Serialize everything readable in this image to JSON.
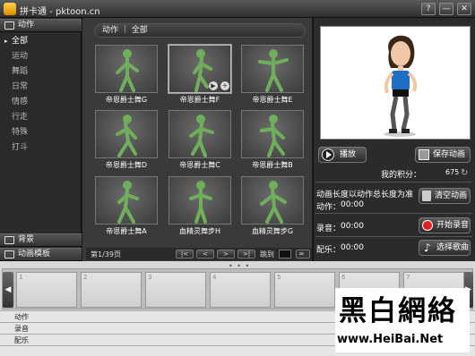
{
  "window": {
    "title": "拼卡通 - pktoon.cn",
    "help_label": "?",
    "minimize_label": "—",
    "maximize_label": "□",
    "close_label": "✕"
  },
  "sidebar": {
    "header": "动作",
    "items": [
      {
        "label": "全部",
        "selected": true
      },
      {
        "label": "运动"
      },
      {
        "label": "舞蹈"
      },
      {
        "label": "日常"
      },
      {
        "label": "情感"
      },
      {
        "label": "行走"
      },
      {
        "label": "特殊"
      },
      {
        "label": "打斗"
      }
    ],
    "bottom_tabs": [
      "背景",
      "动画模板"
    ]
  },
  "main": {
    "breadcrumb": "动作 ｜ 全部",
    "tiles": [
      {
        "label": "帝恩爵士舞G"
      },
      {
        "label": "帝恩爵士舞F",
        "selected": true
      },
      {
        "label": "帝恩爵士舞E"
      },
      {
        "label": "帝恩爵士舞D"
      },
      {
        "label": "帝恩爵士舞C"
      },
      {
        "label": "帝恩爵士舞B"
      },
      {
        "label": "帝恩爵士舞A"
      },
      {
        "label": "血精灵舞步H"
      },
      {
        "label": "血精灵舞步G"
      }
    ],
    "pager": {
      "page_info": "第1/39页",
      "first": "|<",
      "prev": "<",
      "next": ">",
      "last": ">|",
      "goto_label": "跳到",
      "goto_btn": "∞"
    }
  },
  "right": {
    "play_label": "播放",
    "save_label": "保存动画",
    "points_label": "我的积分：",
    "points_value": "675",
    "length_note": "动画长度以动作总长度为准",
    "clear_label": "清空动画",
    "action_time_label": "动作：",
    "action_time": "00:00",
    "record_time_label": "录音：",
    "record_time": "00:00",
    "record_label": "开始录音",
    "music_time_label": "配乐：",
    "music_time": "00:00",
    "music_label": "选择歌曲"
  },
  "timeline": {
    "frames": [
      "1",
      "2",
      "3",
      "4",
      "5",
      "6",
      "7"
    ],
    "tracks": [
      "动作",
      "录音",
      "配乐"
    ]
  },
  "watermark": {
    "big": "黑白網絡",
    "url": "www.HeiBai.Net"
  },
  "colors": {
    "figure_green": "#6fae5a",
    "record_red": "#e02020"
  }
}
